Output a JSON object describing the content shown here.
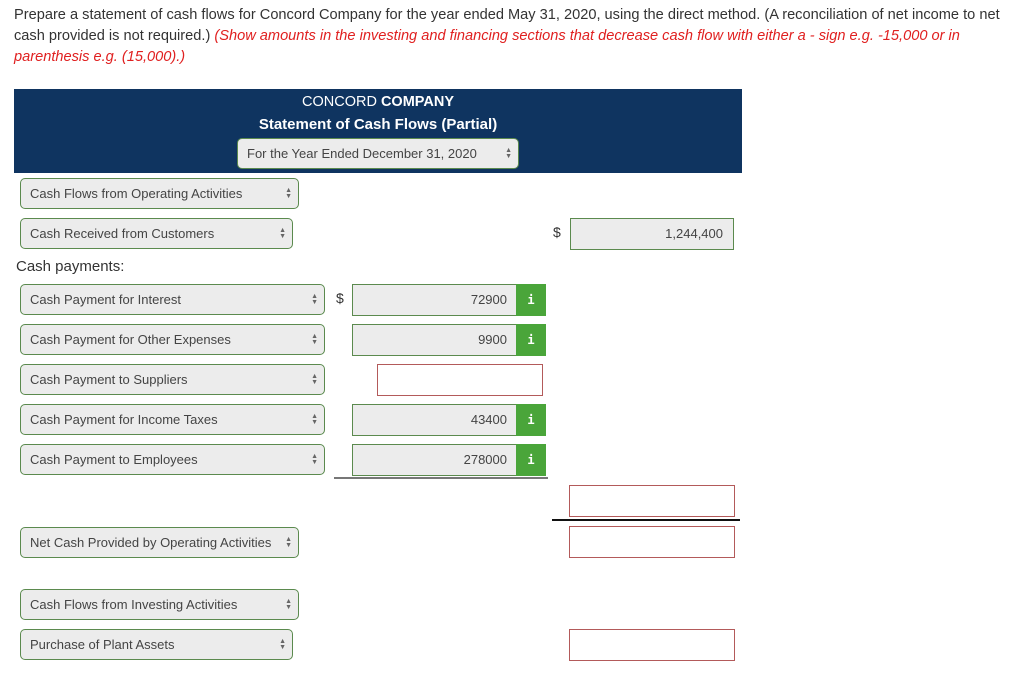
{
  "instructions": {
    "text": "Prepare a statement of cash flows for Concord Company for the year ended May 31, 2020, using the direct method. (A reconciliation of net income to net cash provided is not required.) ",
    "note": "(Show amounts in the investing and financing sections that decrease cash flow with either a - sign e.g. -15,000 or in parenthesis e.g. (15,000).)"
  },
  "header": {
    "company_regular": "CONCORD ",
    "company_bold": "COMPANY",
    "statement_title": "Statement of Cash Flows (Partial)",
    "period_select": "For the Year Ended December 31, 2020"
  },
  "rows": {
    "operating_heading": "Cash Flows from Operating Activities",
    "received_customers": {
      "label": "Cash Received from Customers",
      "currency": "$",
      "value": "1,244,400"
    },
    "cash_payments_label": "Cash payments:",
    "payments": [
      {
        "label": "Cash Payment for Interest",
        "currency": "$",
        "value": "72900",
        "info": "i"
      },
      {
        "label": "Cash Payment for Other Expenses",
        "currency": "",
        "value": "9900",
        "info": "i"
      },
      {
        "label": "Cash Payment to Suppliers",
        "currency": "",
        "value": "",
        "info": ""
      },
      {
        "label": "Cash Payment for Income Taxes",
        "currency": "",
        "value": "43400",
        "info": "i"
      },
      {
        "label": "Cash Payment to Employees",
        "currency": "",
        "value": "278000",
        "info": "i"
      }
    ],
    "total_payments_value": "",
    "net_operating": {
      "label": "Net Cash Provided by Operating Activities",
      "value": ""
    },
    "investing_heading": "Cash Flows from Investing Activities",
    "purchase_plant": {
      "label": "Purchase of Plant Assets",
      "value": ""
    }
  },
  "colors": {
    "header_bg": "#0f3460",
    "accent_green": "#4aa53a",
    "warning_red": "#e02020"
  }
}
